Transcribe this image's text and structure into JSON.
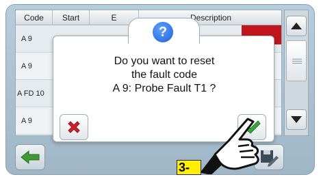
{
  "table": {
    "headers": [
      "Code",
      "Start",
      "E",
      "Description"
    ],
    "rows": [
      {
        "code": "A 9"
      },
      {
        "code": "A 9"
      },
      {
        "code": "A FD 10"
      },
      {
        "code": "A 9"
      }
    ]
  },
  "dialog": {
    "icon": "question-icon",
    "icon_glyph": "?",
    "message_lines": [
      "Do you want to reset",
      "the fault code",
      "A 9: Probe Fault T1 ?"
    ],
    "cancel_icon": "red-x-icon",
    "ok_icon": "green-check-icon"
  },
  "step_label": "3-",
  "colors": {
    "highlight_row": "#c2161e",
    "question": "#1f5fd6",
    "cancel": "#d0202a",
    "ok": "#3aa53a",
    "back_arrow": "#3e9a33",
    "step": "#ffef00"
  }
}
